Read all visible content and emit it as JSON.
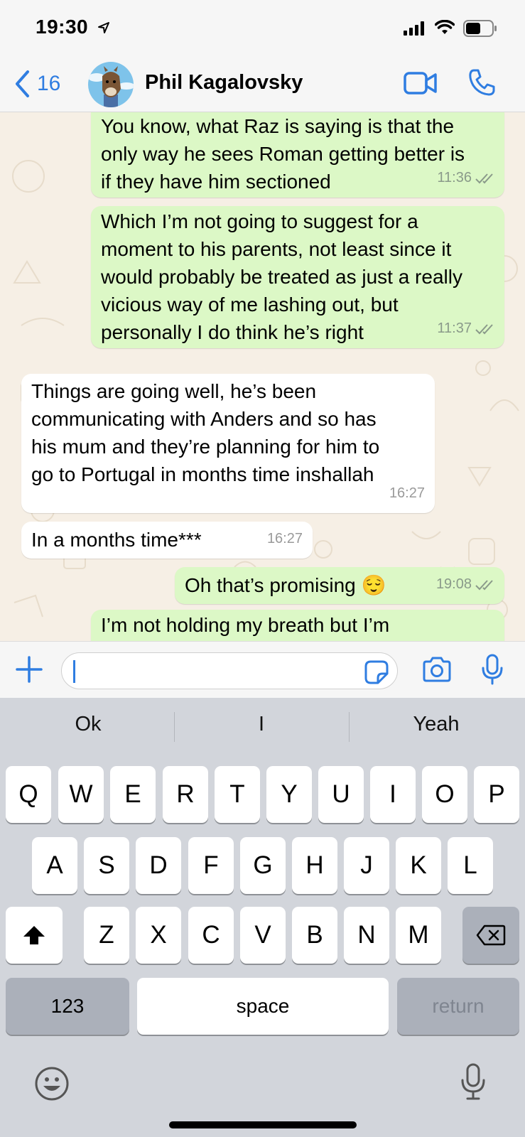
{
  "status_bar": {
    "time": "19:30"
  },
  "header": {
    "back_count": "16",
    "contact_name": "Phil Kagalovsky"
  },
  "messages": [
    {
      "direction": "outgoing",
      "text": "You know, what Raz is saying is that the\nonly way he sees Roman getting better is\nif they have him sectioned",
      "time": "11:36"
    },
    {
      "direction": "outgoing",
      "text": "Which I’m not going to suggest for a\nmoment to his parents, not least since it\nwould probably be treated as just a really\nvicious way of me lashing out, but\npersonally I do think he’s right",
      "time": "11:37"
    },
    {
      "direction": "incoming",
      "text": "Things are going well, he’s been\ncommunicating with Anders and so has\nhis mum and they’re planning for him to\ngo to Portugal in months time inshallah",
      "time": "16:27"
    },
    {
      "direction": "incoming",
      "text": "In a months time***",
      "time": "16:27"
    },
    {
      "direction": "outgoing",
      "text": "Oh that’s promising 😌",
      "time": "19:08"
    },
    {
      "direction": "outgoing",
      "text": "I’m not holding my breath but I’m",
      "time": ""
    }
  ],
  "composer": {
    "input_value": ""
  },
  "keyboard": {
    "suggestions": [
      "Ok",
      "I",
      "Yeah"
    ],
    "row1": [
      "Q",
      "W",
      "E",
      "R",
      "T",
      "Y",
      "U",
      "I",
      "O",
      "P"
    ],
    "row2": [
      "A",
      "S",
      "D",
      "F",
      "G",
      "H",
      "J",
      "K",
      "L"
    ],
    "row3": [
      "Z",
      "X",
      "C",
      "V",
      "B",
      "N",
      "M"
    ],
    "numbers_label": "123",
    "space_label": "space",
    "return_label": "return"
  },
  "colors": {
    "accent": "#2f7de1",
    "outgoing_bubble": "#dcf8c6",
    "incoming_bubble": "#ffffff",
    "keyboard_bg": "#d2d5db"
  },
  "icons": [
    "location-arrow-icon",
    "signal-icon",
    "wifi-icon",
    "battery-icon",
    "chevron-left-icon",
    "video-call-icon",
    "phone-icon",
    "plus-icon",
    "sticker-icon",
    "camera-icon",
    "microphone-icon",
    "shift-icon",
    "backspace-icon",
    "emoji-icon",
    "dictation-icon"
  ]
}
